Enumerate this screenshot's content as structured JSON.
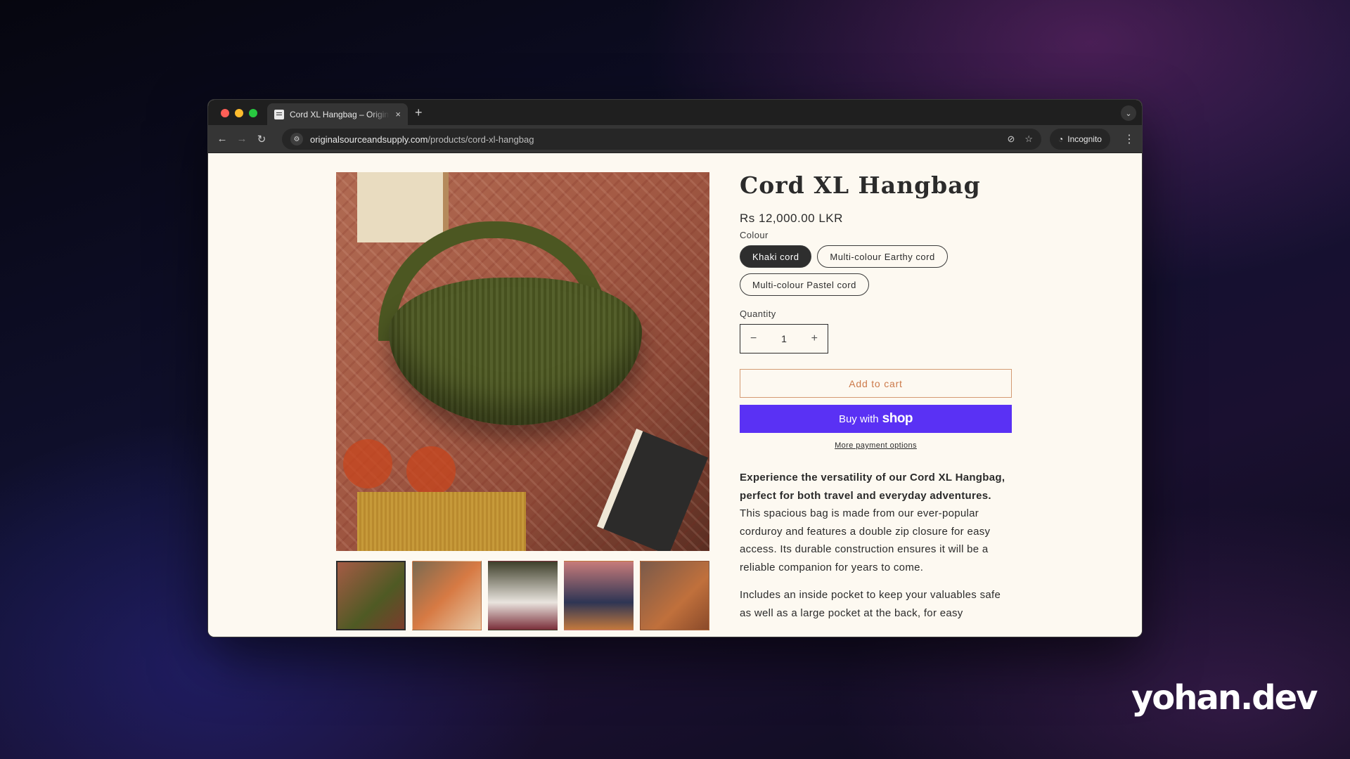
{
  "browser": {
    "tab_title": "Cord XL Hangbag – Original Source and Supply",
    "tab_close": "×",
    "new_tab": "+",
    "tab_menu": "⌄",
    "nav": {
      "back": "←",
      "forward": "→",
      "reload": "↻"
    },
    "site_icon": "⚙",
    "url_domain": "originalsourceandsupply.com",
    "url_path": "/products/cord-xl-hangbag",
    "omnibox_icons": {
      "tracking": "⊘",
      "bookmark": "☆"
    },
    "incognito_icon": "◔",
    "incognito_label": "Incognito",
    "menu": "⋮"
  },
  "product": {
    "title": "Cord XL Hangbag",
    "price": "Rs 12,000.00 LKR",
    "colour_label": "Colour",
    "colours": [
      "Khaki cord",
      "Multi-colour Earthy cord",
      "Multi-colour Pastel cord"
    ],
    "selected_colour": "Khaki cord",
    "quantity_label": "Quantity",
    "quantity": "1",
    "decrease": "−",
    "increase": "+",
    "add_to_cart": "Add to cart",
    "buy_with": "Buy with",
    "shop_word": "shop",
    "more_payment": "More payment options",
    "desc_bold": "Experience the versatility of our Cord XL Hangbag, perfect for both travel and everyday adventures.",
    "desc_rest": " This spacious bag is made from our ever-popular corduroy and features a double zip closure for easy access. Its durable construction ensures it will be a reliable companion for years to come.",
    "desc2": "Includes an inside pocket to keep your valuables safe as well as a large pocket at the back, for easy"
  },
  "watermark": "yohan.dev"
}
